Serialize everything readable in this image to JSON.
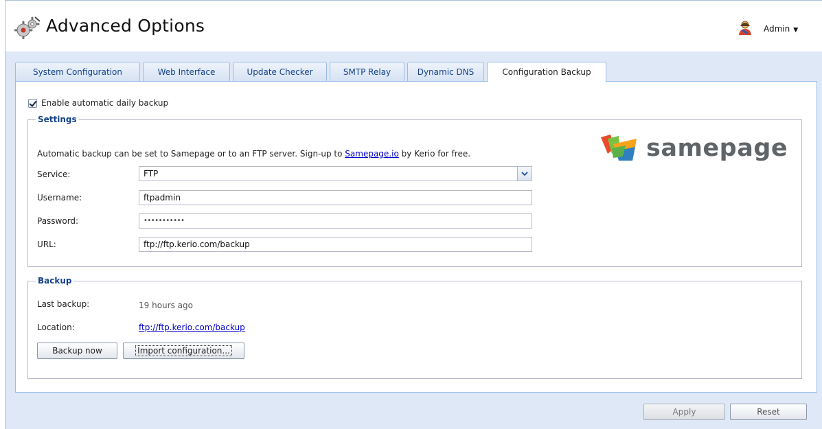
{
  "header": {
    "title": "Advanced Options",
    "icon": "gears-icon",
    "user": {
      "icon": "user-icon",
      "label": "Admin"
    }
  },
  "tabs": [
    {
      "label": "System Configuration",
      "active": false
    },
    {
      "label": "Web Interface",
      "active": false
    },
    {
      "label": "Update Checker",
      "active": false
    },
    {
      "label": "SMTP Relay",
      "active": false
    },
    {
      "label": "Dynamic DNS",
      "active": false
    },
    {
      "label": "Configuration Backup",
      "active": true
    }
  ],
  "enable_backup": {
    "label": "Enable automatic daily backup",
    "checked": true
  },
  "settings": {
    "legend": "Settings",
    "intro_prefix": "Automatic backup can be set to Samepage or to an FTP server. Sign-up to ",
    "intro_link": "Samepage.io",
    "intro_suffix": " by Kerio for free.",
    "service_label": "Service:",
    "service_value": "FTP",
    "username_label": "Username:",
    "username_value": "ftpadmin",
    "password_label": "Password:",
    "password_value": "•••••••••••",
    "url_label": "URL:",
    "url_value": "ftp://ftp.kerio.com/backup",
    "logo_text": "samepage"
  },
  "backup": {
    "legend": "Backup",
    "last_label": "Last backup:",
    "last_value": "19 hours ago",
    "location_label": "Location:",
    "location_value": "ftp://ftp.kerio.com/backup",
    "backup_now": "Backup now",
    "import_config": "Import configuration..."
  },
  "footer": {
    "apply": "Apply",
    "reset": "Reset"
  },
  "colors": {
    "tab_text": "#15428b",
    "link": "#0000cc",
    "panel_bg": "#dfe8f6"
  }
}
